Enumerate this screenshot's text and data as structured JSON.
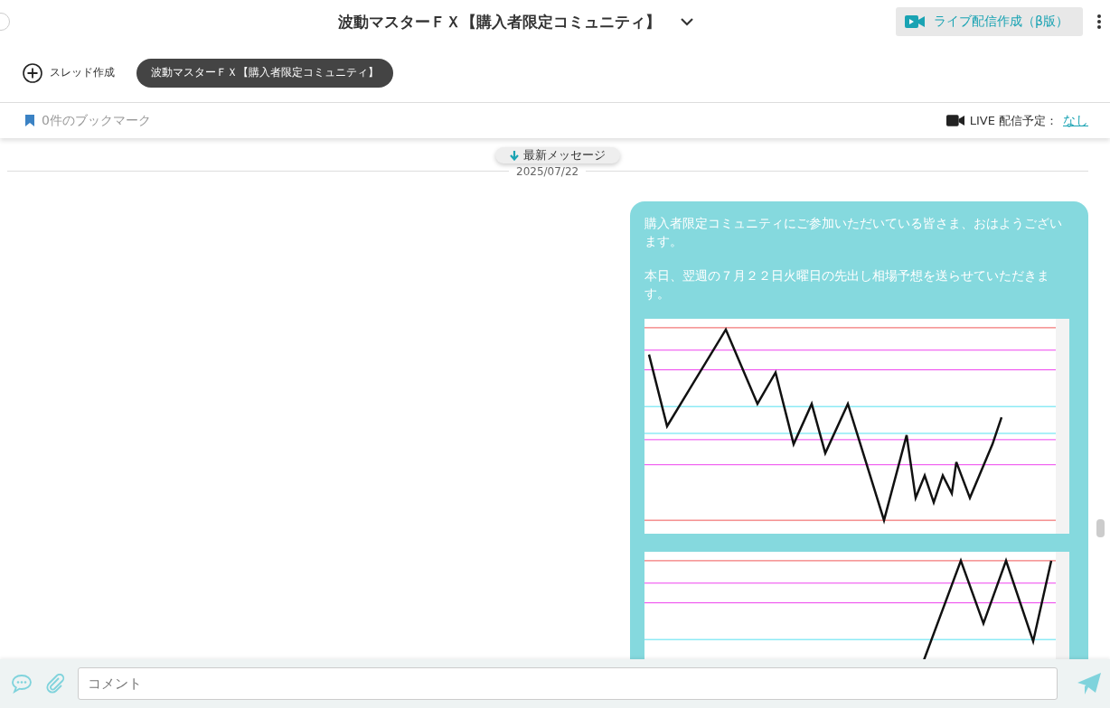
{
  "header": {
    "title": "波動マスターＦＸ【購入者限定コミュニティ】",
    "live_button": "ライブ配信作成（β版）"
  },
  "threads": {
    "create": "スレッド作成",
    "tabs": [
      {
        "label": "波動マスターＦＸ【購入者限定コミュニティ】",
        "selected": true
      }
    ]
  },
  "info_bar": {
    "bookmarks": "0件のブックマーク",
    "live_label": "LIVE 配信予定：",
    "live_value": "なし"
  },
  "messages": {
    "jump_button": "最新メッセージ",
    "date": "2025/07/22",
    "items": [
      {
        "paragraphs": [
          "購入者限定コミュニティにご参加いただいている皆さま、おはようございます。",
          "本日、翌週の７月２２日火曜日の先出し相場予想を送らせていただきます。"
        ]
      }
    ]
  },
  "composer": {
    "placeholder": "コメント"
  }
}
